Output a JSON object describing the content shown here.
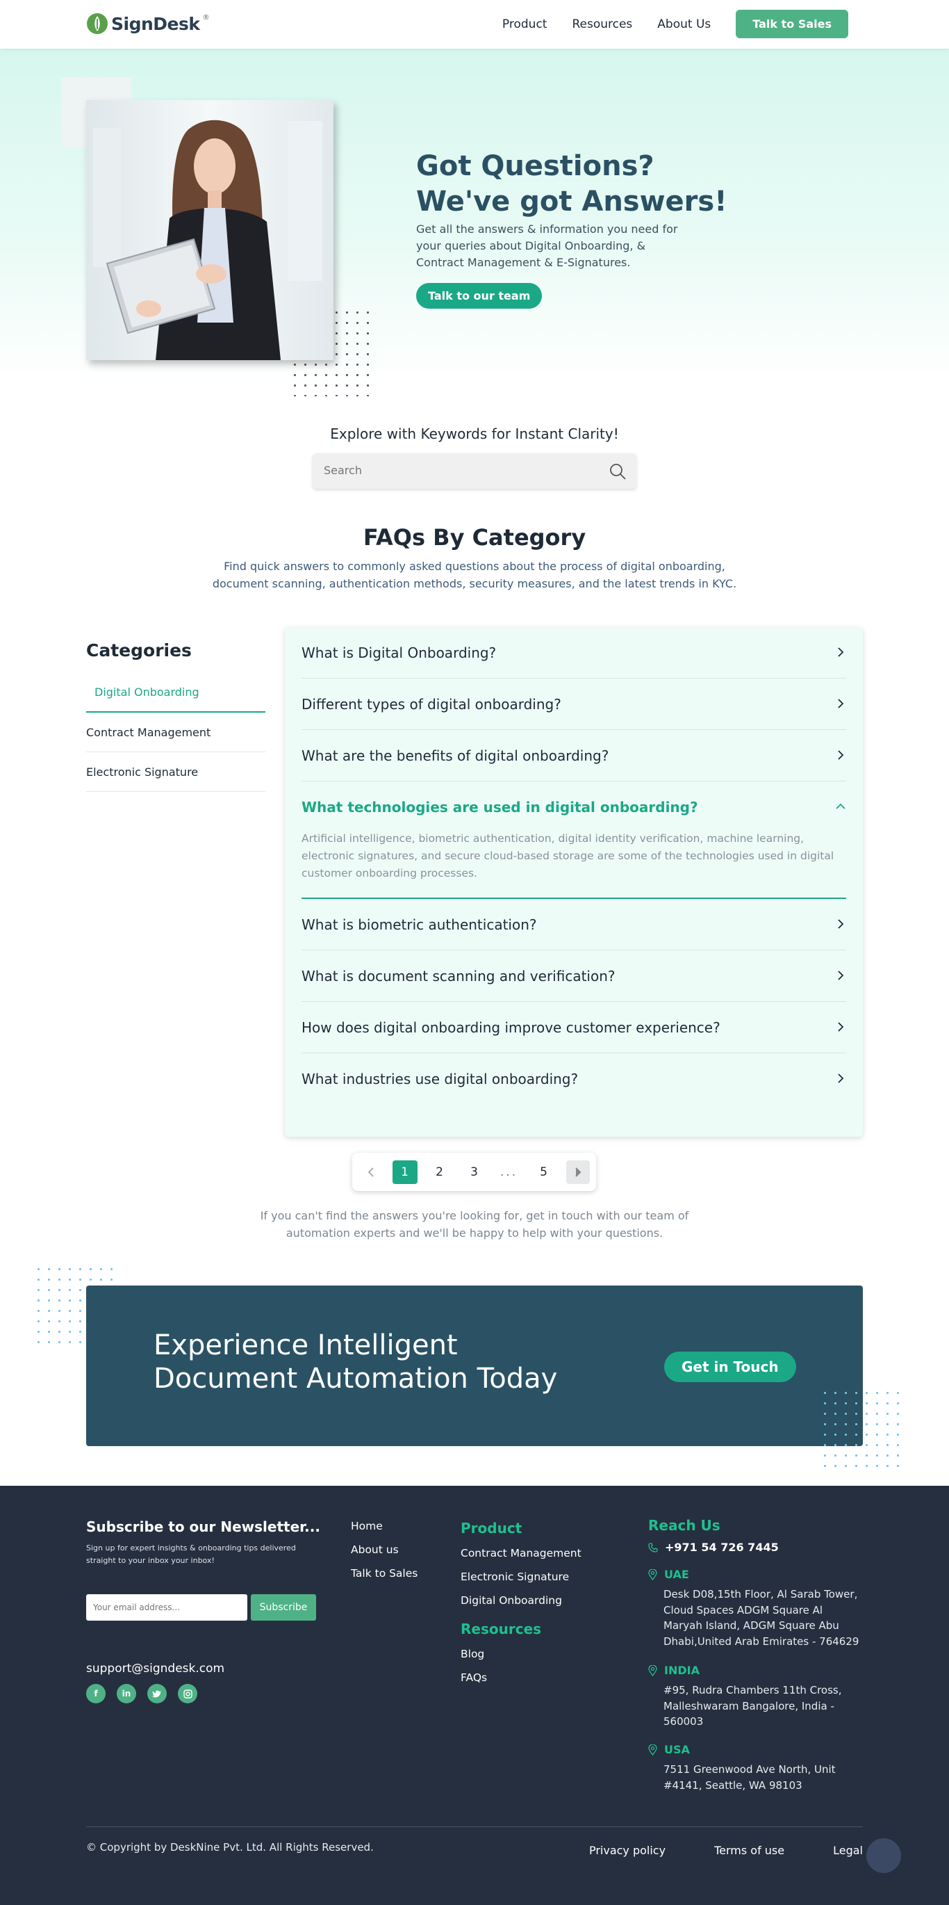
{
  "brand": {
    "name": "SignDesk",
    "reg_mark": "®"
  },
  "nav": {
    "items": [
      "Product",
      "Resources",
      "About Us"
    ],
    "cta": "Talk to Sales"
  },
  "hero": {
    "title_line1": "Got Questions?",
    "title_line2": "We've got Answers!",
    "description": "Get all the answers & information you need for your queries about Digital Onboarding, & Contract Management & E-Signatures.",
    "button": "Talk to our team"
  },
  "search": {
    "heading": "Explore with Keywords for Instant Clarity!",
    "placeholder": "Search"
  },
  "faq": {
    "title": "FAQs By Category",
    "subtitle": "Find quick answers to commonly asked questions about the process of digital onboarding, document scanning, authentication methods, security measures, and the latest trends in KYC.",
    "categories_title": "Categories",
    "categories": [
      "Digital Onboarding",
      "Contract Management",
      "Electronic Signature"
    ],
    "active_category": "Digital Onboarding",
    "questions": [
      {
        "q": "What is Digital Onboarding?"
      },
      {
        "q": "Different types of digital onboarding?"
      },
      {
        "q": "What are the benefits of digital onboarding?"
      },
      {
        "q": "What technologies are used in digital onboarding?",
        "a": "Artificial intelligence, biometric authentication, digital identity verification, machine learning, electronic signatures, and secure cloud-based storage are some of the technologies used in digital customer onboarding processes.",
        "open": true
      },
      {
        "q": "What is biometric authentication?"
      },
      {
        "q": "What is document scanning and verification?"
      },
      {
        "q": "How does digital onboarding improve customer experience?"
      },
      {
        "q": "What industries use digital onboarding?"
      }
    ]
  },
  "pagination": {
    "pages": [
      "1",
      "2",
      "3",
      "...",
      "5"
    ],
    "current": "1"
  },
  "help_text": "If you can't find the answers you're looking for, get in touch with our team of automation experts and we'll be happy to help with your questions.",
  "cta": {
    "title_line1": "Experience Intelligent",
    "title_line2": "Document Automation Today",
    "button": "Get in Touch"
  },
  "footer": {
    "newsletter_title": "Subscribe to our Newsletter...",
    "newsletter_sub": "Sign up for expert insights & onboarding tips delivered straight to your inbox your inbox!",
    "email_placeholder": "Your email address...",
    "subscribe": "Subscribe",
    "support_email": "support@signdesk.com",
    "socials": [
      "facebook-icon",
      "linkedin-icon",
      "twitter-icon",
      "instagram-icon"
    ],
    "links": [
      "Home",
      "About us",
      "Talk to Sales"
    ],
    "product_title": "Product",
    "product_links": [
      "Contract Management",
      "Electronic Signature",
      "Digital Onboarding"
    ],
    "resources_title": "Resources",
    "resources_links": [
      "Blog",
      "FAQs"
    ],
    "reach_title": "Reach Us",
    "phone": "+971 54 726 7445",
    "offices": [
      {
        "name": "UAE",
        "address": "Desk D08,15th Floor, Al Sarab Tower, Cloud Spaces ADGM Square Al Maryah Island, ADGM Square Abu Dhabi,United Arab Emirates - 764629"
      },
      {
        "name": "INDIA",
        "address": "#95, Rudra Chambers 11th Cross, Malleshwaram Bangalore, India - 560003"
      },
      {
        "name": "USA",
        "address": "7511 Greenwood Ave North, Unit #4141, Seattle, WA 98103"
      }
    ],
    "copyright": "© Copyright by DeskNine Pvt. Ltd. All Rights Reserved.",
    "legal_links": [
      "Privacy policy",
      "Terms of use",
      "Legal"
    ]
  },
  "colors": {
    "accent": "#1ba886",
    "brand_green": "#4fb286",
    "dark": "#2a5264",
    "footer": "#262f3f"
  }
}
